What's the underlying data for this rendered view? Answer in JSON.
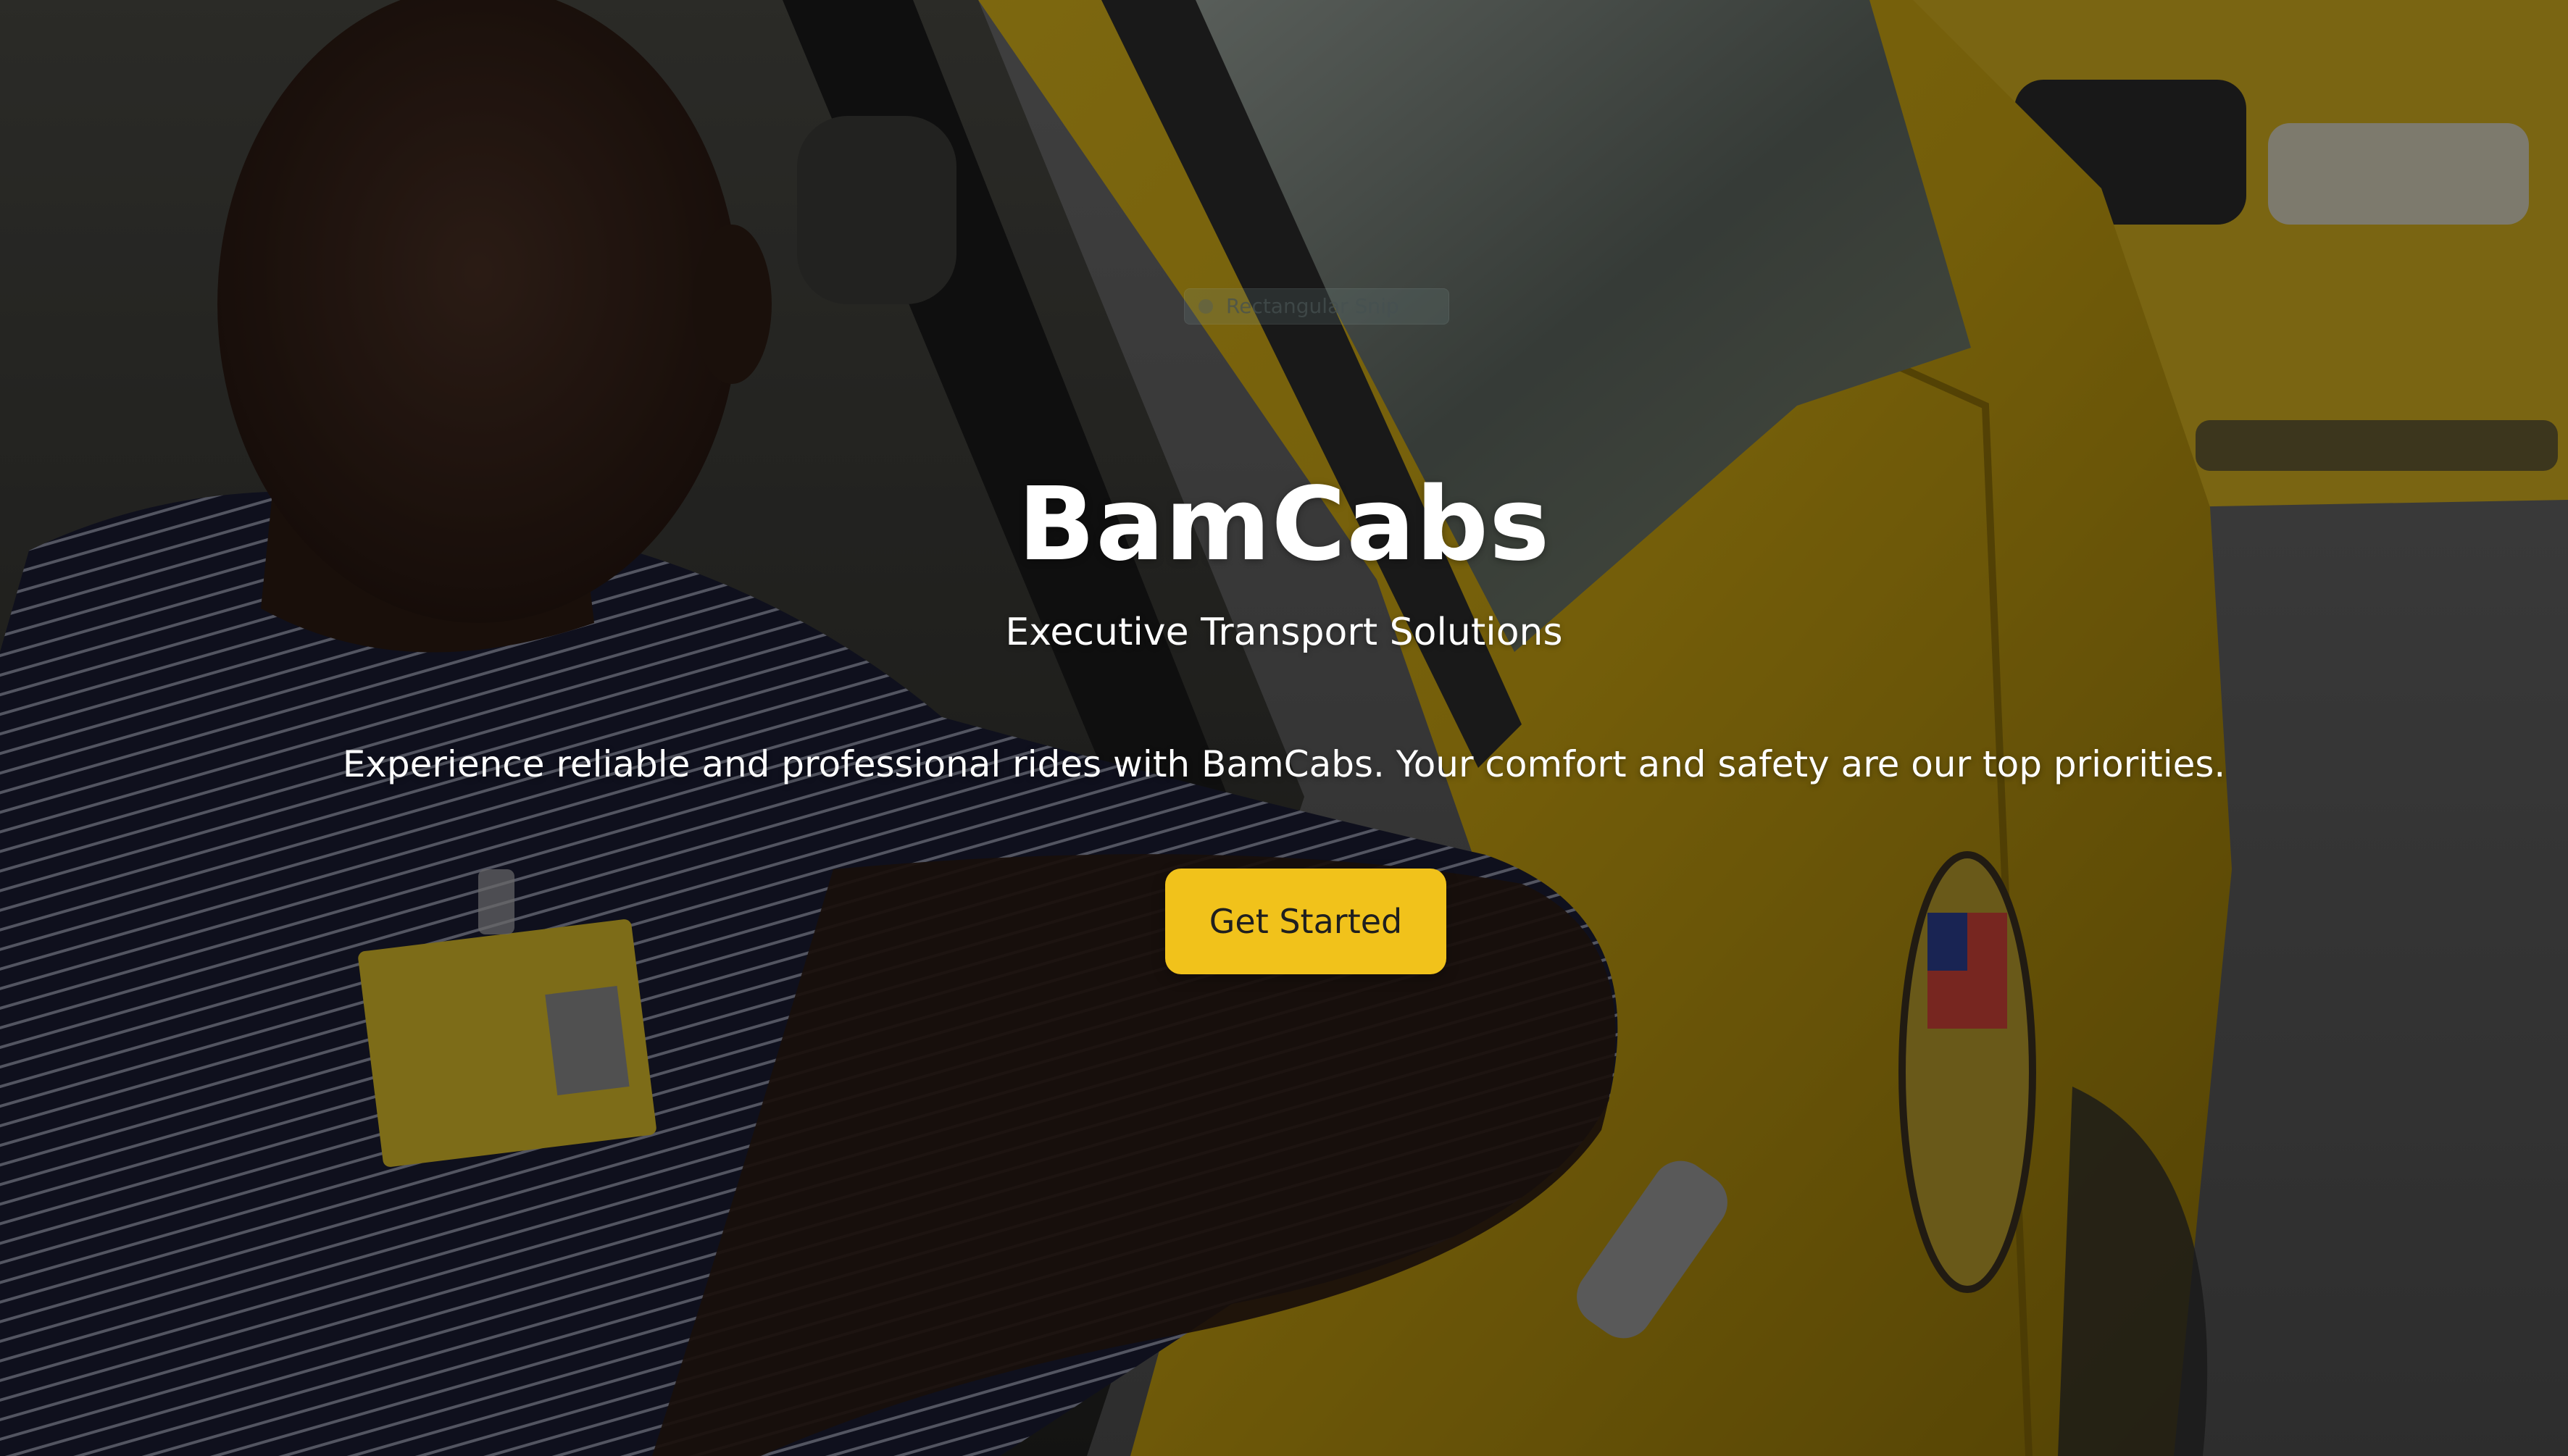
{
  "brand": {
    "name": "BamCabs",
    "accent_color": "#f1c21b"
  },
  "hero": {
    "title": "BamCabs",
    "subtitle": "Executive Transport Solutions",
    "description": "Experience reliable and professional rides with BamCabs. Your comfort and safety are our top priorities.",
    "cta_label": "Get Started",
    "background": "photo: smiling taxi driver leaning out of a yellow cab window"
  },
  "overlay_hint": {
    "label": "Rectangular Snip"
  }
}
